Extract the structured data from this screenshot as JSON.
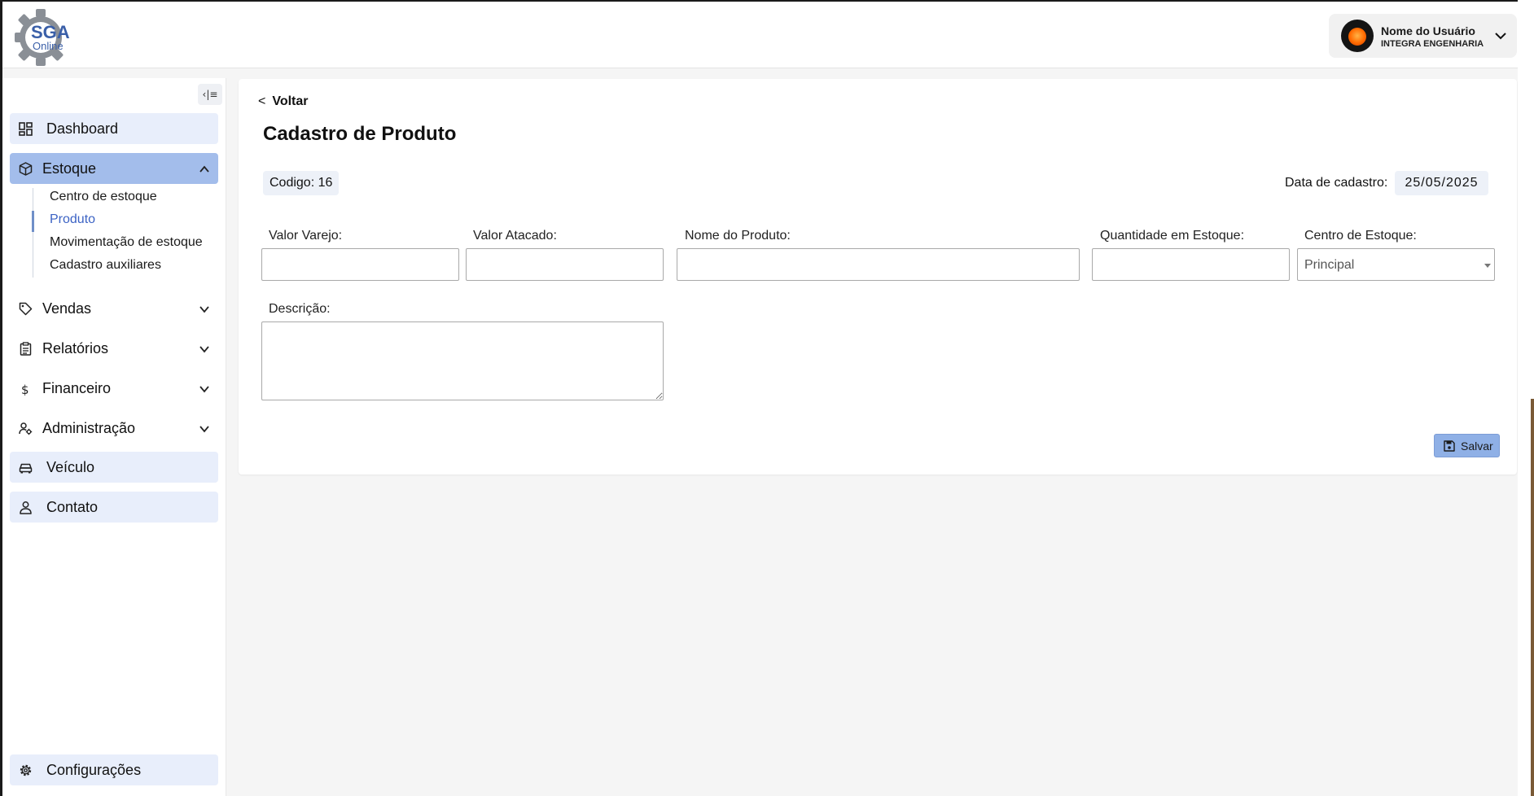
{
  "header": {
    "logo_text": "SGA",
    "logo_subtext": "Online",
    "user_name": "Nome do Usuário",
    "user_company": "INTEGRA ENGENHARIA"
  },
  "sidebar": {
    "collapse_icon": "‹|≡",
    "items": [
      {
        "label": "Dashboard",
        "icon": "dashboard-icon"
      },
      {
        "label": "Estoque",
        "icon": "box-icon",
        "expanded": true
      },
      {
        "label": "Vendas",
        "icon": "tag-icon"
      },
      {
        "label": "Relatórios",
        "icon": "clipboard-icon"
      },
      {
        "label": "Financeiro",
        "icon": "dollar-icon"
      },
      {
        "label": "Administração",
        "icon": "user-gear-icon"
      },
      {
        "label": "Veículo",
        "icon": "car-icon"
      },
      {
        "label": "Contato",
        "icon": "person-icon"
      }
    ],
    "estoque_submenu": [
      {
        "label": "Centro de estoque"
      },
      {
        "label": "Produto",
        "active": true
      },
      {
        "label": "Movimentação de estoque"
      },
      {
        "label": "Cadastro auxiliares"
      }
    ],
    "settings_label": "Configurações"
  },
  "main": {
    "back_icon": "<",
    "back_label": "Voltar",
    "title": "Cadastro de Produto",
    "codigo": "Codigo: 16",
    "data_label": "Data de cadastro:",
    "data_value": "25/05/2025",
    "fields": {
      "valor_varejo": {
        "label": "Valor Varejo:",
        "value": ""
      },
      "valor_atacado": {
        "label": "Valor Atacado:",
        "value": ""
      },
      "nome_produto": {
        "label": "Nome do Produto:",
        "value": ""
      },
      "quantidade": {
        "label": "Quantidade em Estoque:",
        "value": ""
      },
      "centro": {
        "label": "Centro de Estoque:",
        "value": "Principal"
      },
      "descricao": {
        "label": "Descrição:",
        "value": ""
      }
    },
    "save_label": "Salvar"
  },
  "colors": {
    "active_nav": "#a3bdeb",
    "nav_box": "#e8eefb",
    "submenu_active": "#3c63c4",
    "save_button": "#8fb0e6"
  }
}
